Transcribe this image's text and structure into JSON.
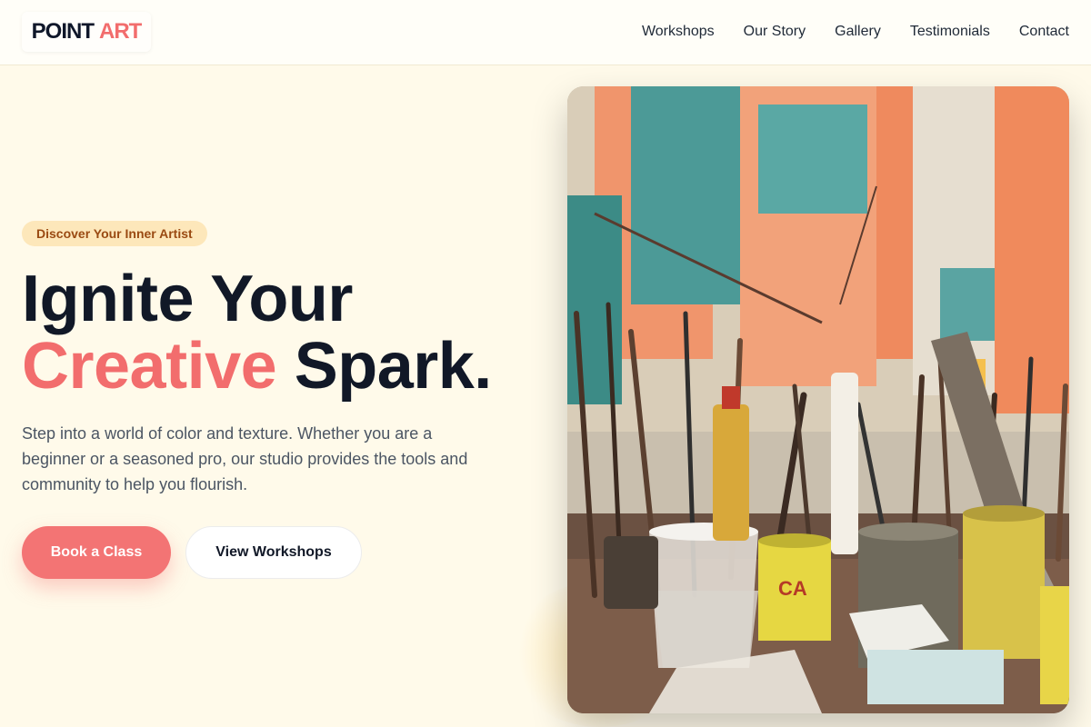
{
  "header": {
    "logo": {
      "part1": "POINT",
      "part2": "ART"
    },
    "nav": [
      "Workshops",
      "Our Story",
      "Gallery",
      "Testimonials",
      "Contact"
    ]
  },
  "hero": {
    "badge": "Discover Your Inner Artist",
    "headline": {
      "line1": "Ignite Your",
      "accent": "Creative",
      "rest": "Spark."
    },
    "description": "Step into a world of color and texture. Whether you are a beginner or a seasoned pro, our studio provides the tools and community to help you flourish.",
    "primary_button": "Book a Class",
    "secondary_button": "View Workshops",
    "image_description": "paint-brushes-in-cans-photo"
  },
  "colors": {
    "accent": "#f26d6d",
    "background": "#fffaea",
    "badge_bg": "#fde7ba",
    "badge_text": "#9a4a12",
    "text_dark": "#111827"
  }
}
